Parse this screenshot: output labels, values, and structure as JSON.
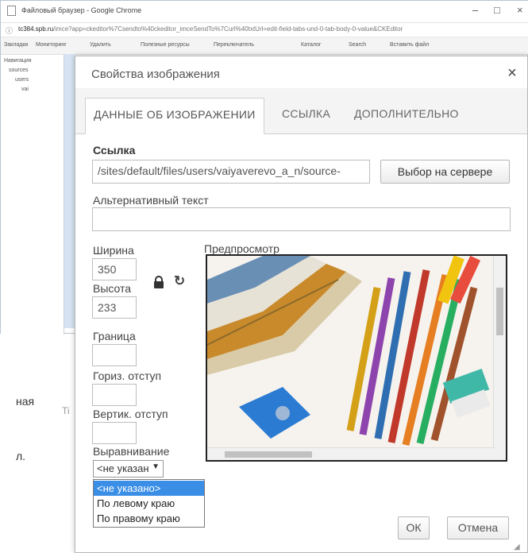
{
  "browser": {
    "window_title": "Файловый браузер - Google Chrome",
    "url_host": "tc384.spb.ru",
    "url_rest": "/imce?app=ckeditor%7Csendto%40ckeditor_imceSendTo%7Curl%40txtUrl=edit-field-tabs-und-0-tab-body-0-value&CKEditor",
    "bookmarks": [
      "Закладки",
      "Мониторинг",
      "Удалить",
      "Полезные ресурсы",
      "Переключатель",
      "Каталог",
      "Search",
      "Вставить файл"
    ],
    "tree": [
      "Навигация",
      "sources",
      "users",
      "vai"
    ]
  },
  "background_fragments": [
    "ная",
    "л.",
    "Ti"
  ],
  "dialog": {
    "title": "Свойства изображения",
    "tabs": [
      "ДАННЫЕ ОБ ИЗОБРАЖЕНИИ",
      "ССЫЛКА",
      "ДОПОЛНИТЕЛЬНО"
    ],
    "url_label": "Ссылка",
    "url_value": "/sites/default/files/users/vaiyaverevo_a_n/source-",
    "browse_button": "Выбор на сервере",
    "alt_label": "Альтернативный текст",
    "alt_value": "",
    "width_label": "Ширина",
    "width_value": "350",
    "height_label": "Высота",
    "height_value": "233",
    "border_label": "Граница",
    "border_value": "",
    "hspace_label": "Гориз. отступ",
    "hspace_value": "",
    "vspace_label": "Вертик. отступ",
    "vspace_value": "",
    "align_label": "Выравнивание",
    "align_selected": "<не указан",
    "align_options": [
      "<не указано>",
      "По левому краю",
      "По правому краю"
    ],
    "preview_label": "Предпросмотр",
    "ok_button": "ОК",
    "cancel_button": "Отмена"
  },
  "icons": {
    "close": "close-icon",
    "lock": "lock-icon",
    "reset": "reset-size-icon",
    "dropdown": "chevron-down-icon"
  },
  "colors": {
    "selected_option": "#3a8ee6",
    "tab_strip": "#f4f4f4",
    "browser_sidebar": "#d7e3f2"
  }
}
